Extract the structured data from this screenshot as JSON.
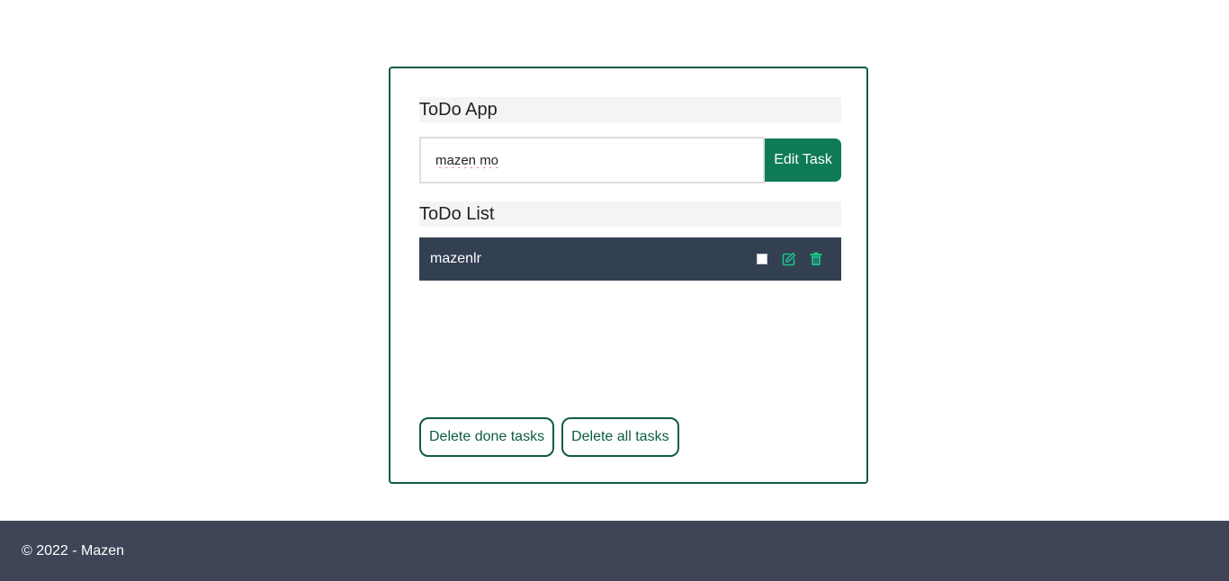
{
  "app": {
    "title": "ToDo App"
  },
  "task_form": {
    "input_value": "mazen mo",
    "submit_label": "Edit Task"
  },
  "list": {
    "title": "ToDo List",
    "tasks": [
      {
        "label": "mazenlr",
        "done": false
      }
    ]
  },
  "actions": {
    "delete_done_label": "Delete done tasks",
    "delete_all_label": "Delete all tasks"
  },
  "footer": {
    "text": "© 2022 - Mazen"
  },
  "colors": {
    "accent": "#0f5b47",
    "button": "#0e7a58",
    "task_bg": "#334052",
    "icon": "#19c38a",
    "footer_bg": "#3e4556"
  },
  "icons": {
    "edit": "edit-icon",
    "delete": "trash-icon"
  }
}
